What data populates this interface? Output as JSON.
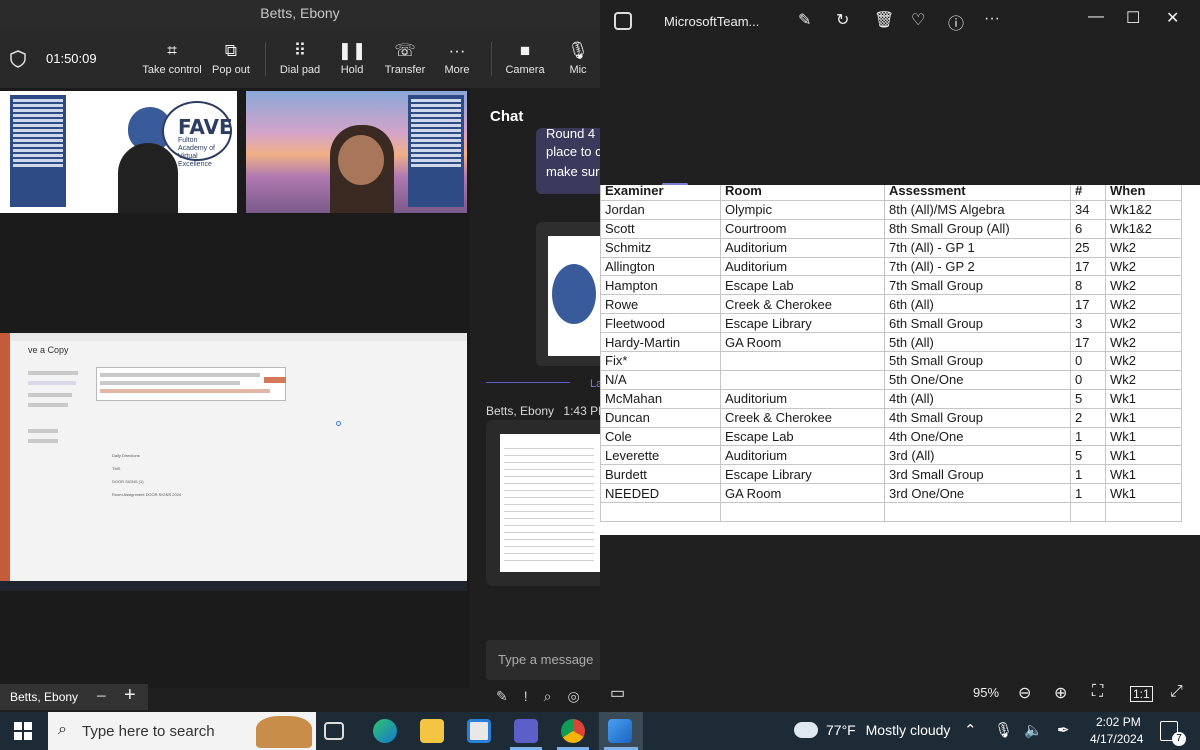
{
  "teams": {
    "window_title": "Betts, Ebony",
    "timer": "01:50:09",
    "toolbar": [
      {
        "label": "Take control",
        "icon": "take-control-icon",
        "glyph": "⌗"
      },
      {
        "label": "Pop out",
        "icon": "pop-out-icon",
        "glyph": "⧉"
      },
      {
        "label": "Dial pad",
        "icon": "dial-pad-icon",
        "glyph": "⠿"
      },
      {
        "label": "Hold",
        "icon": "hold-icon",
        "glyph": "❚❚"
      },
      {
        "label": "Transfer",
        "icon": "transfer-icon",
        "glyph": "☏"
      },
      {
        "label": "More",
        "icon": "more-icon",
        "glyph": "···"
      },
      {
        "label": "Camera",
        "icon": "camera-icon",
        "glyph": "■"
      },
      {
        "label": "Mic",
        "icon": "mic-icon",
        "glyph": "🎙"
      }
    ],
    "tile1": {
      "brand": "FAVE",
      "brand_sub": "Fulton Academy of Virtual Excellence"
    },
    "shared_screen": {
      "dialog_title": "ve a Copy",
      "folder_items": [
        "Daily Directions",
        "TMS",
        "DOOR SIGNS (1)",
        "Room Assignment DOOR SIGNS 2024"
      ]
    },
    "chat": {
      "title": "Chat",
      "bubble_lines": [
        "Round 4",
        "place to c",
        "make sur"
      ],
      "divider_label": "La",
      "sender": "Betts, Ebony",
      "time": "1:43 PM",
      "input_placeholder": "Type a message"
    },
    "participant_name": "Betts, Ebony",
    "zoom_controls": "—+"
  },
  "photos": {
    "app_name": "MicrosoftTeam...",
    "zoom": "95%",
    "table": {
      "headers": [
        "Examiner",
        "Room",
        "Assessment",
        "#",
        "When"
      ],
      "rows": [
        [
          "Jordan",
          "Olympic",
          "8th (All)/MS Algebra",
          "34",
          "Wk1&2"
        ],
        [
          "Scott",
          "Courtroom",
          "8th Small Group (All)",
          "6",
          "Wk1&2"
        ],
        [
          "Schmitz",
          "Auditorium",
          "7th (All) - GP 1",
          "25",
          "Wk2"
        ],
        [
          "Allington",
          "Auditorium",
          "7th (All) - GP 2",
          "17",
          "Wk2"
        ],
        [
          "Hampton",
          "Escape Lab",
          "7th Small Group",
          "8",
          "Wk2"
        ],
        [
          "Rowe",
          "Creek & Cherokee",
          "6th (All)",
          "17",
          "Wk2"
        ],
        [
          "Fleetwood",
          "Escape Library",
          "6th Small Group",
          "3",
          "Wk2"
        ],
        [
          "Hardy-Martin",
          "GA Room",
          "5th (All)",
          "17",
          "Wk2"
        ],
        [
          "Fix*",
          "",
          "5th Small Group",
          "0",
          "Wk2"
        ],
        [
          "N/A",
          "",
          "5th One/One",
          "0",
          "Wk2"
        ],
        [
          "McMahan",
          "Auditorium",
          "4th (All)",
          "5",
          "Wk1"
        ],
        [
          "Duncan",
          "Creek & Cherokee",
          "4th Small Group",
          "2",
          "Wk1"
        ],
        [
          "Cole",
          "Escape Lab",
          "4th One/One",
          "1",
          "Wk1"
        ],
        [
          "Leverette",
          "Auditorium",
          "3rd (All)",
          "5",
          "Wk1"
        ],
        [
          "Burdett",
          "Escape Library",
          "3rd Small Group",
          "1",
          "Wk1"
        ],
        [
          "NEEDED",
          "GA Room",
          "3rd One/One",
          "1",
          "Wk1"
        ],
        [
          "",
          "",
          "",
          "",
          ""
        ]
      ]
    }
  },
  "taskbar": {
    "search_placeholder": "Type here to search",
    "weather_temp": "77°F",
    "weather_desc": "Mostly cloudy",
    "time": "2:02 PM",
    "date": "4/17/2024",
    "notification_count": "7",
    "pinned_apps": [
      "task-view",
      "edge",
      "file-explorer",
      "microsoft-store",
      "teams",
      "chrome",
      "photos"
    ]
  },
  "colors": {
    "teams_accent": "#5b5fc7",
    "taskbar_bg": "#1d2b37",
    "fave_blue": "#2d3d62"
  }
}
